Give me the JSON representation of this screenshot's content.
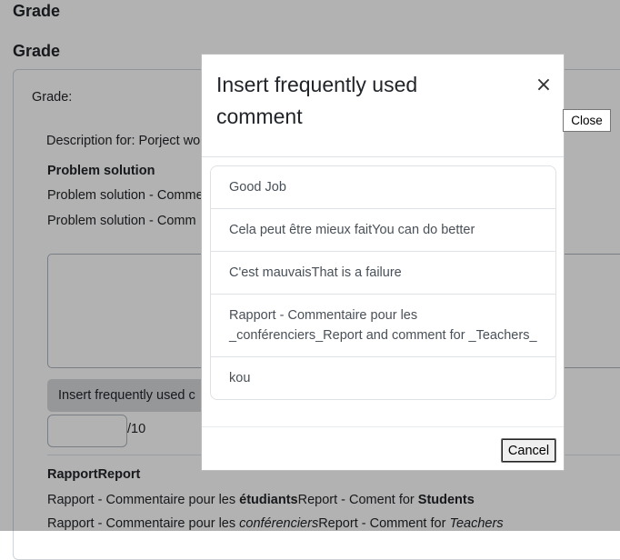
{
  "page": {
    "heading_top": "Grade",
    "heading_second": "Grade",
    "grade_label": "Grade:",
    "description": "Description for: Porject wo",
    "problem_heading": "Problem solution",
    "problem_comment_1": "Problem solution - Comme",
    "problem_comment_2": "Problem solution - Comm",
    "insert_button_label": "Insert frequently used c",
    "grade_suffix": "/10",
    "rapport_heading": "RapportReport",
    "rapport_line_1": {
      "p1": "Rapport - Commentaire pour les ",
      "b1": "étudiants",
      "p2": "Report - Coment for ",
      "b2": "Students"
    },
    "rapport_line_2": {
      "p1": "Rapport - Commentaire pour les ",
      "i1": "conférenciers",
      "p2": "Report - Comment for ",
      "i2": "Teachers"
    }
  },
  "modal": {
    "title": "Insert frequently used comment",
    "close_symbol": "×",
    "items": [
      "Good Job",
      "Cela peut être mieux faitYou can do better",
      "C'est mauvaisThat is a failure",
      "Rapport - Commentaire pour les _conférenciers_Report and comment for _Teachers_",
      "kou"
    ],
    "cancel_label": "Cancel"
  },
  "tooltip": {
    "text": "Close"
  }
}
